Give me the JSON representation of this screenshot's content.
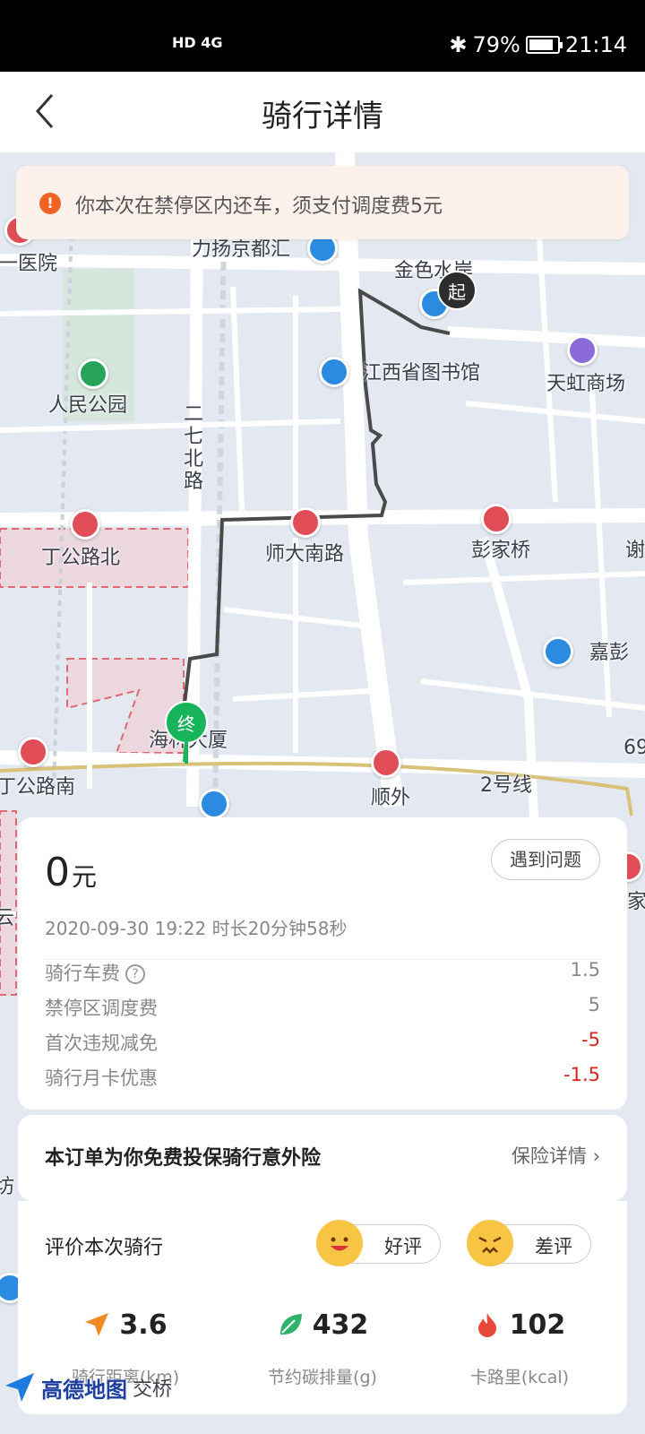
{
  "status_bar": {
    "network": "HD 4G",
    "battery": "79%",
    "time": "21:14"
  },
  "nav": {
    "title": "骑行详情"
  },
  "notice": {
    "text": "你本次在禁停区内还车，须支付调度费5元"
  },
  "map": {
    "labels": [
      "力扬京都汇",
      "金色水岸",
      "江西省图书馆",
      "天虹商场",
      "人民公园",
      "二七北路",
      "一医院",
      "丁公路北",
      "师大南路",
      "彭家桥",
      "谢",
      "嘉彭",
      "海林大厦",
      "丁公路南",
      "顺外",
      "2号线",
      "69",
      "家",
      "云",
      "坊"
    ],
    "start_pin": "起",
    "end_pin": "终",
    "logo": "高德地图",
    "logo_tail": "交桥"
  },
  "trip": {
    "price": "0",
    "price_unit": "元",
    "issue_button": "遇到问题",
    "meta": "2020-09-30 19:22  时长20分钟58秒",
    "fees": [
      {
        "label": "骑行车费",
        "value": "1.5",
        "negative": false,
        "has_help": true
      },
      {
        "label": "禁停区调度费",
        "value": "5",
        "negative": false,
        "has_help": false
      },
      {
        "label": "首次违规减免",
        "value": "-5",
        "negative": true,
        "has_help": false
      },
      {
        "label": "骑行月卡优惠",
        "value": "-1.5",
        "negative": true,
        "has_help": false
      }
    ]
  },
  "insurance": {
    "title": "本订单为你免费投保骑行意外险",
    "link": "保险详情"
  },
  "rating": {
    "title": "评价本次骑行",
    "good": "好评",
    "bad": "差评"
  },
  "stats": [
    {
      "value": "3.6",
      "label": "骑行距离(km)",
      "icon": "navigation-arrow-icon",
      "color": "#f08a24"
    },
    {
      "value": "432",
      "label": "节约碳排量(g)",
      "icon": "leaf-icon",
      "color": "#2fb36a"
    },
    {
      "value": "102",
      "label": "卡路里(kcal)",
      "icon": "flame-icon",
      "color": "#e8473a"
    }
  ]
}
